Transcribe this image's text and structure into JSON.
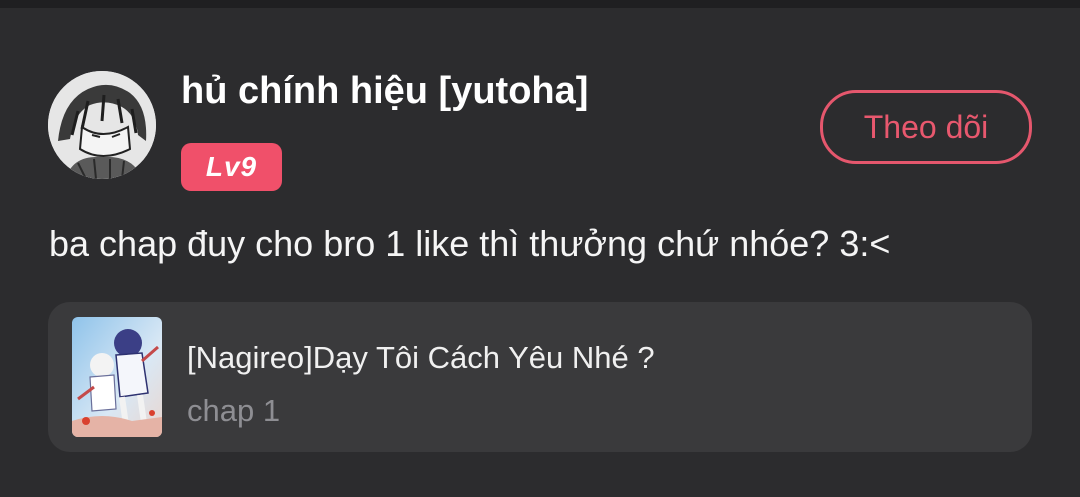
{
  "comment": {
    "user": {
      "name": "hủ chính hiệu [yutoha]",
      "level_badge": "Lv9",
      "avatar_icon": "anime-character-avatar"
    },
    "follow_button_label": "Theo dõi",
    "text": "ba chap đuy cho bro 1 like thì thưởng chứ nhóe? 3:<",
    "manga": {
      "title": "[Nagireo]Dạy Tôi Cách Yêu Nhé ?",
      "chapter": "chap 1",
      "cover_icon": "manga-cover-art"
    }
  },
  "colors": {
    "background": "#2c2c2e",
    "accent": "#e8586e",
    "badge": "#f0506a",
    "card": "#3a3a3c",
    "muted_text": "#8e8e93"
  }
}
